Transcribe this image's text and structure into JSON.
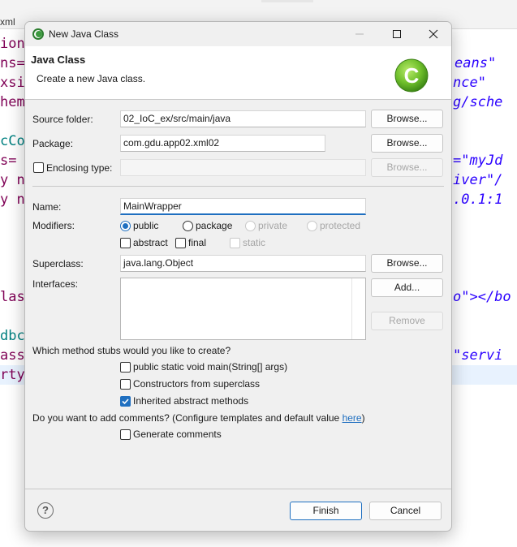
{
  "background": {
    "tabs": [
      "xml"
    ],
    "code_left": [
      "ion",
      "ns=",
      "xsi",
      "hem",
      "",
      "cCo",
      "s=",
      "y n",
      "y n",
      "",
      "",
      "",
      "las",
      "",
      "dbc",
      "ass",
      "rty"
    ],
    "code_right": [
      "eans\"",
      "nce\"",
      "g/sche",
      "=\"myJd",
      "iver\"/",
      ".0.1:1",
      "o\"></bo",
      "\"servi"
    ]
  },
  "dialog": {
    "window_title": "New Java Class",
    "title_icon": "eclipse-icon",
    "window_buttons": {
      "minimize": "minimize-icon",
      "maximize": "maximize-icon",
      "close": "close-icon"
    },
    "header": {
      "title": "Java Class",
      "description": "Create a new Java class.",
      "logo_icon": "java-class-logo-icon",
      "logo_color": "#6fbf2b"
    },
    "source_folder": {
      "label": "Source folder:",
      "value": "02_IoC_ex/src/main/java",
      "browse": "Browse..."
    },
    "package": {
      "label": "Package:",
      "value": "com.gdu.app02.xml02",
      "browse": "Browse..."
    },
    "enclosing_type": {
      "label": "Enclosing type:",
      "value": "",
      "checked": false,
      "browse": "Browse..."
    },
    "name": {
      "label": "Name:",
      "value": "MainWrapper"
    },
    "modifiers": {
      "label": "Modifiers:",
      "access": [
        {
          "label": "public",
          "selected": true,
          "enabled": true
        },
        {
          "label": "package",
          "selected": false,
          "enabled": true
        },
        {
          "label": "private",
          "selected": false,
          "enabled": false
        },
        {
          "label": "protected",
          "selected": false,
          "enabled": false
        }
      ],
      "other": [
        {
          "label": "abstract",
          "checked": false,
          "enabled": true
        },
        {
          "label": "final",
          "checked": false,
          "enabled": true
        },
        {
          "label": "static",
          "checked": false,
          "enabled": false
        }
      ]
    },
    "superclass": {
      "label": "Superclass:",
      "value": "java.lang.Object",
      "browse": "Browse..."
    },
    "interfaces": {
      "label": "Interfaces:",
      "add": "Add...",
      "remove": "Remove"
    },
    "stubs": {
      "question": "Which method stubs would you like to create?",
      "options": [
        {
          "label": "public static void main(String[] args)",
          "checked": false
        },
        {
          "label": "Constructors from superclass",
          "checked": false
        },
        {
          "label": "Inherited abstract methods",
          "checked": true
        }
      ]
    },
    "comments": {
      "question": "Do you want to add comments? (Configure templates and default value ",
      "link": "here",
      "question_end": ")",
      "option": {
        "label": "Generate comments",
        "checked": false
      }
    },
    "footer": {
      "help_icon": "help-icon",
      "finish": "Finish",
      "cancel": "Cancel"
    },
    "accent_color": "#1f6fc0"
  }
}
